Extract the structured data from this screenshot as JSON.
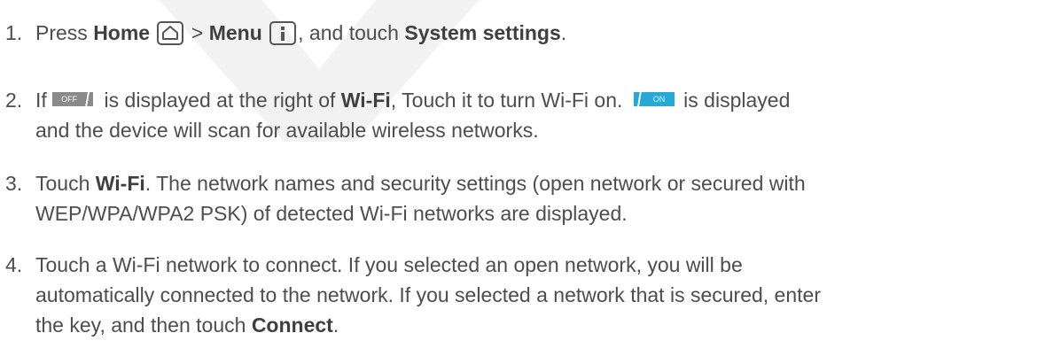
{
  "steps": [
    {
      "number": "1.",
      "parts": {
        "p1": "Press ",
        "home": "Home",
        "sep": " > ",
        "menu": "Menu",
        "p2": ", and touch ",
        "system_settings": "System settings",
        "p3": "."
      }
    },
    {
      "number": "2.",
      "parts": {
        "p1": "If ",
        "toggle_off": "OFF",
        "p2": " is displayed at the right of ",
        "wifi": "Wi-Fi",
        "p3": ", Touch it to turn Wi-Fi on. ",
        "toggle_on": "ON",
        "p4": " is displayed",
        "line2": "and the device will scan for available wireless networks."
      }
    },
    {
      "number": "3.",
      "parts": {
        "p1": "Touch ",
        "wifi": "Wi-Fi",
        "p2": ". The network names and security settings (open network or secured with",
        "line2": "WEP/WPA/WPA2 PSK) of detected Wi-Fi networks are displayed."
      }
    },
    {
      "number": "4.",
      "parts": {
        "line1": "Touch a Wi-Fi network to connect. If you selected an open network, you will be",
        "line2": "automatically connected to the network. If you selected a network that is secured, enter",
        "p1": "the key, and then touch ",
        "connect": "Connect",
        "p2": "."
      }
    }
  ],
  "icons": {
    "home": "home-icon",
    "menu": "menu-icon",
    "toggle_off": "toggle-off-icon",
    "toggle_on": "toggle-on-icon"
  },
  "colors": {
    "text": "#4d4d4d",
    "toggle_on": "#27a9d8",
    "toggle_off": "#8a8a8a",
    "watermark": "#f2f2f2"
  }
}
